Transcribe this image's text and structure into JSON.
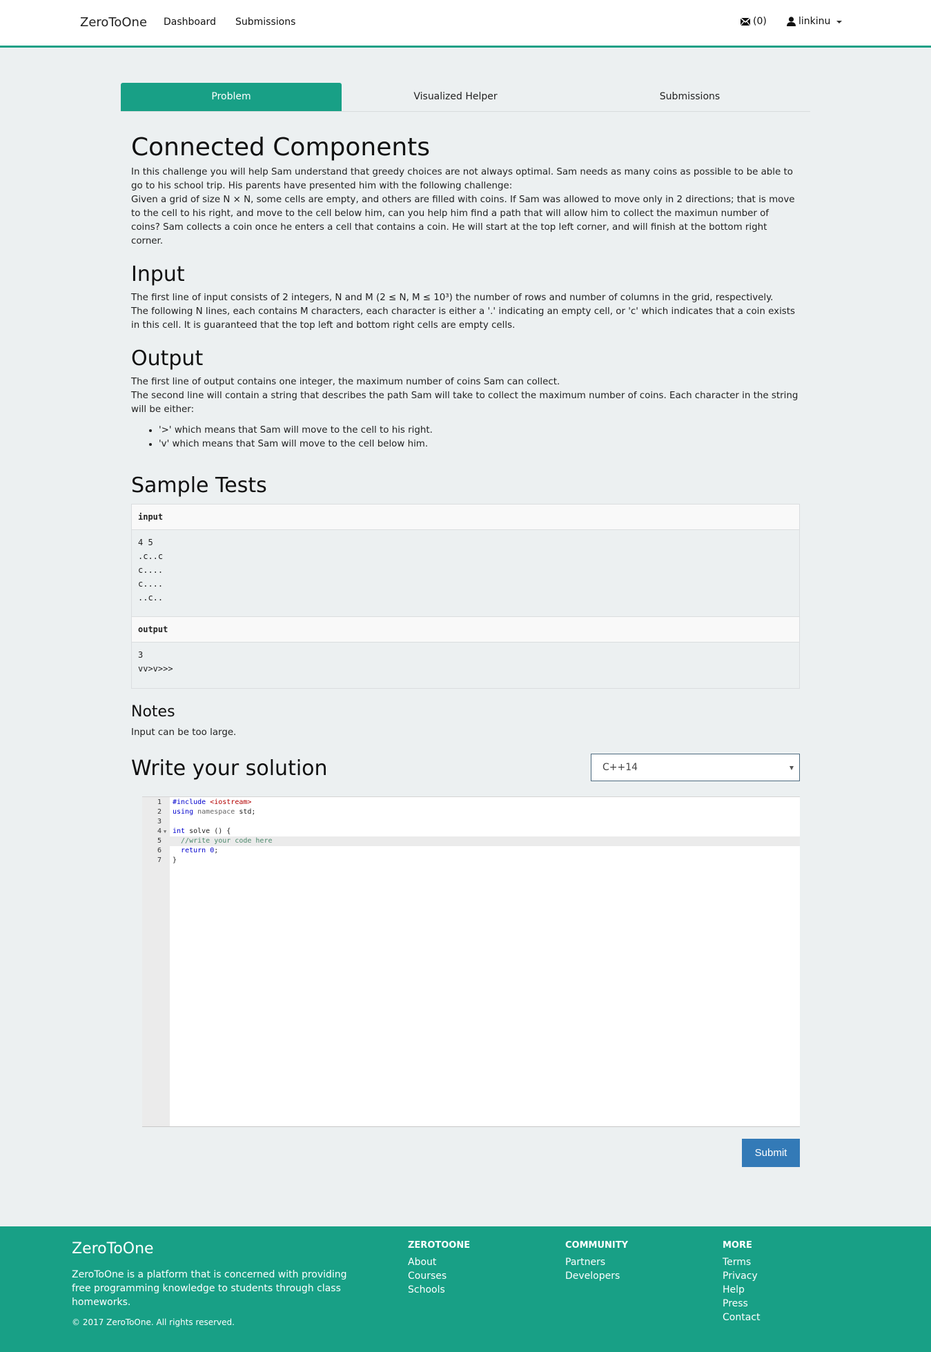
{
  "navbar": {
    "brand": "ZeroToOne",
    "links": [
      "Dashboard",
      "Submissions"
    ],
    "mail_count": "(0)",
    "username": "linkinu"
  },
  "tabs": [
    "Problem",
    "Visualized Helper",
    "Submissions"
  ],
  "active_tab": "Problem",
  "problem": {
    "title": "Connected Components",
    "intro": [
      "In this challenge you will help Sam understand that greedy choices are not always optimal. Sam needs as many coins as possible to be able to go to his school trip. His parents have presented him with the following challenge:",
      "Given a grid of size N × N, some cells are empty, and others are filled with coins. If Sam was allowed to move only in 2 directions; that is move to the cell to his right, and move to the cell below him, can you help him find a path that will allow him to collect the maximun number of coins? Sam collects a coin once he enters a cell that contains a coin. He will start at the top left corner, and will finish at the bottom right corner."
    ],
    "input_heading": "Input",
    "input_text": [
      "The first line of input consists of 2 integers, N and M (2 ≤ N, M ≤ 10³) the number of rows and number of columns in the grid, respectively.",
      "The following N lines, each contains M characters, each character is either a '.' indicating an empty cell, or 'c' which indicates that a coin exists in this cell. It is guaranteed that the top left and bottom right cells are empty cells."
    ],
    "output_heading": "Output",
    "output_text": [
      "The first line of output contains one integer, the maximum number of coins Sam can collect.",
      "The second line will contain a string that describes the path Sam will take to collect the maximum number of coins. Each character in the string will be either:"
    ],
    "output_bullets": [
      "'>' which means that Sam will move to the cell to his right.",
      "'v' which means that Sam will move to the cell below him."
    ],
    "sample_heading": "Sample Tests",
    "sample": {
      "input_label": "input",
      "input_value": "4 5\n.c..c\nc....\nc....\n..c..",
      "output_label": "output",
      "output_value": "3\nvv>v>>>"
    },
    "notes_heading": "Notes",
    "notes_text": "Input can be too large."
  },
  "solution": {
    "heading": "Write your solution",
    "language": "C++14",
    "code_lines": [
      {
        "n": "1",
        "text": "#include <iostream>"
      },
      {
        "n": "2",
        "text": "using namespace std;"
      },
      {
        "n": "3",
        "text": ""
      },
      {
        "n": "4",
        "text": "int solve () {"
      },
      {
        "n": "5",
        "text": "  //write your code here"
      },
      {
        "n": "6",
        "text": "  return 0;"
      },
      {
        "n": "7",
        "text": "}"
      }
    ],
    "active_line": 5,
    "submit_label": "Submit"
  },
  "footer": {
    "brand": "ZeroToOne",
    "description": "ZeroToOne is a platform that is concerned with providing free programming knowledge to students through class homeworks.",
    "copyright": "© 2017 ZeroToOne. All rights reserved.",
    "columns": [
      {
        "title": "ZEROTOONE",
        "links": [
          "About",
          "Courses",
          "Schools"
        ]
      },
      {
        "title": "COMMUNITY",
        "links": [
          "Partners",
          "Developers"
        ]
      },
      {
        "title": "MORE",
        "links": [
          "Terms",
          "Privacy",
          "Help",
          "Press",
          "Contact"
        ]
      }
    ]
  },
  "colors": {
    "accent": "#18a086",
    "submit": "#337ab7",
    "background": "#ecf0f1"
  }
}
